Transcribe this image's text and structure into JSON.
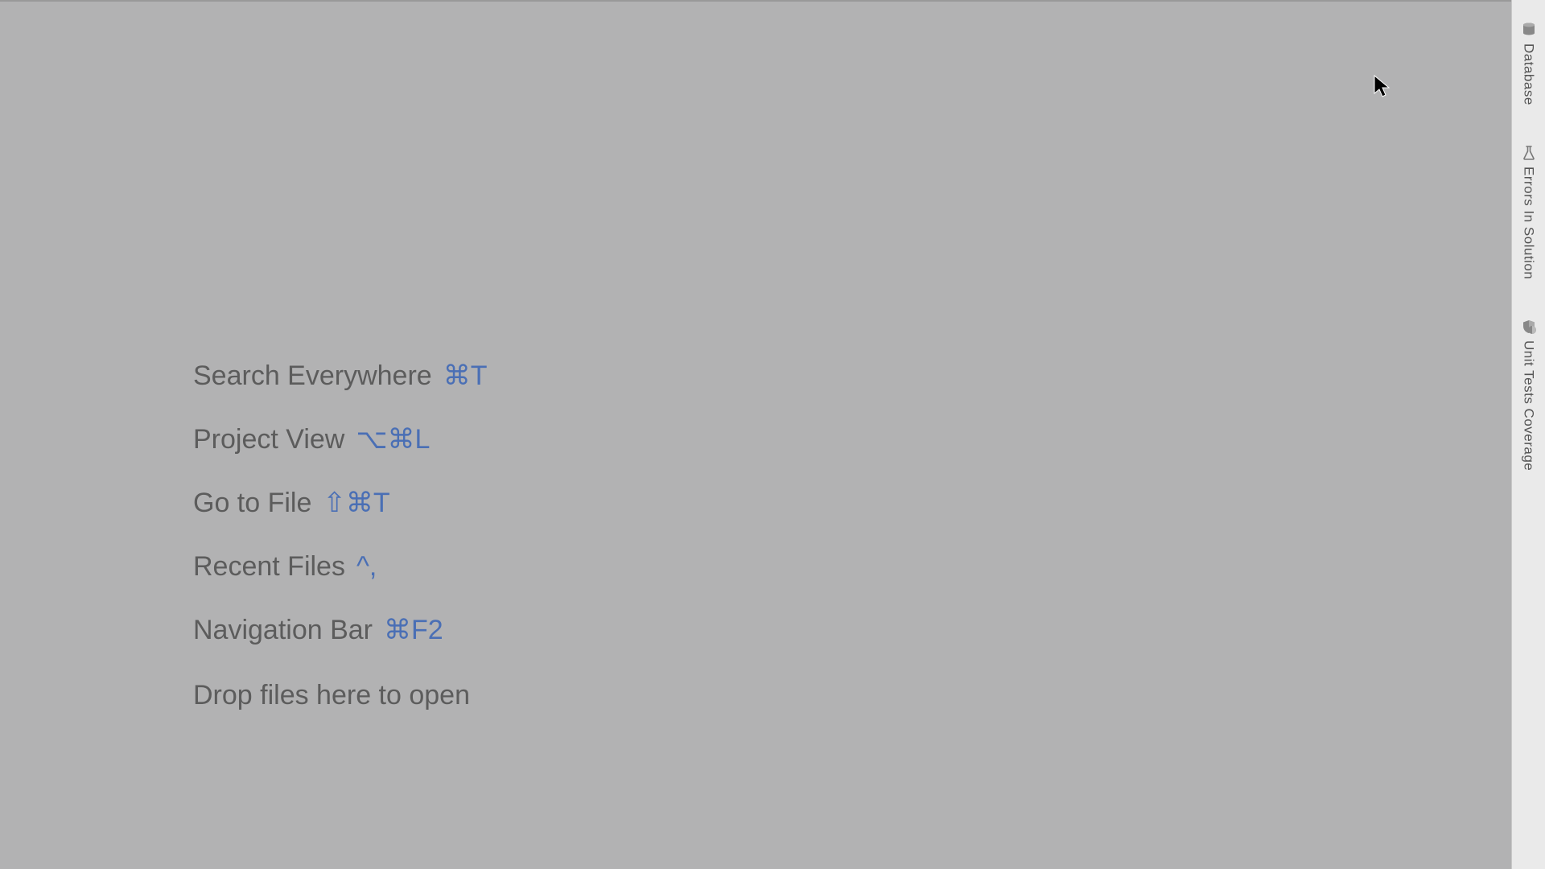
{
  "shortcuts": {
    "items": [
      {
        "action": "Search Everywhere",
        "key": "⌘T"
      },
      {
        "action": "Project View",
        "key": "⌥⌘L"
      },
      {
        "action": "Go to File",
        "key": "⇧⌘T"
      },
      {
        "action": "Recent Files",
        "key": "^,"
      },
      {
        "action": "Navigation Bar",
        "key": "⌘F2"
      }
    ],
    "drop_hint": "Drop files here to open"
  },
  "sidebar": {
    "tabs": [
      {
        "label": "Database"
      },
      {
        "label": "Errors In Solution"
      },
      {
        "label": "Unit Tests Coverage"
      }
    ]
  }
}
